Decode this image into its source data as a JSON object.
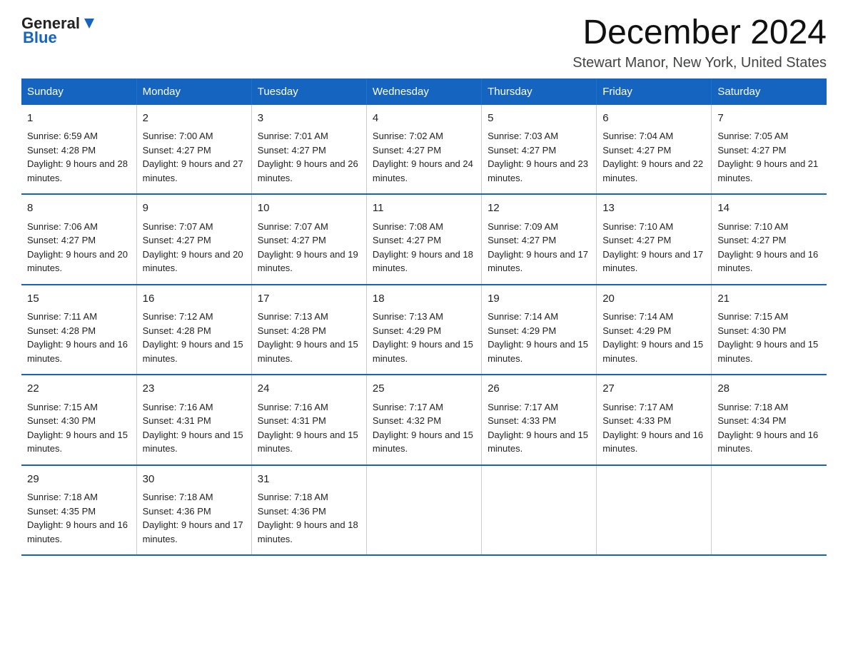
{
  "logo": {
    "general": "General",
    "blue": "Blue"
  },
  "title": "December 2024",
  "location": "Stewart Manor, New York, United States",
  "days_header": [
    "Sunday",
    "Monday",
    "Tuesday",
    "Wednesday",
    "Thursday",
    "Friday",
    "Saturday"
  ],
  "weeks": [
    [
      {
        "day": "1",
        "sunrise": "6:59 AM",
        "sunset": "4:28 PM",
        "daylight": "9 hours and 28 minutes."
      },
      {
        "day": "2",
        "sunrise": "7:00 AM",
        "sunset": "4:27 PM",
        "daylight": "9 hours and 27 minutes."
      },
      {
        "day": "3",
        "sunrise": "7:01 AM",
        "sunset": "4:27 PM",
        "daylight": "9 hours and 26 minutes."
      },
      {
        "day": "4",
        "sunrise": "7:02 AM",
        "sunset": "4:27 PM",
        "daylight": "9 hours and 24 minutes."
      },
      {
        "day": "5",
        "sunrise": "7:03 AM",
        "sunset": "4:27 PM",
        "daylight": "9 hours and 23 minutes."
      },
      {
        "day": "6",
        "sunrise": "7:04 AM",
        "sunset": "4:27 PM",
        "daylight": "9 hours and 22 minutes."
      },
      {
        "day": "7",
        "sunrise": "7:05 AM",
        "sunset": "4:27 PM",
        "daylight": "9 hours and 21 minutes."
      }
    ],
    [
      {
        "day": "8",
        "sunrise": "7:06 AM",
        "sunset": "4:27 PM",
        "daylight": "9 hours and 20 minutes."
      },
      {
        "day": "9",
        "sunrise": "7:07 AM",
        "sunset": "4:27 PM",
        "daylight": "9 hours and 20 minutes."
      },
      {
        "day": "10",
        "sunrise": "7:07 AM",
        "sunset": "4:27 PM",
        "daylight": "9 hours and 19 minutes."
      },
      {
        "day": "11",
        "sunrise": "7:08 AM",
        "sunset": "4:27 PM",
        "daylight": "9 hours and 18 minutes."
      },
      {
        "day": "12",
        "sunrise": "7:09 AM",
        "sunset": "4:27 PM",
        "daylight": "9 hours and 17 minutes."
      },
      {
        "day": "13",
        "sunrise": "7:10 AM",
        "sunset": "4:27 PM",
        "daylight": "9 hours and 17 minutes."
      },
      {
        "day": "14",
        "sunrise": "7:10 AM",
        "sunset": "4:27 PM",
        "daylight": "9 hours and 16 minutes."
      }
    ],
    [
      {
        "day": "15",
        "sunrise": "7:11 AM",
        "sunset": "4:28 PM",
        "daylight": "9 hours and 16 minutes."
      },
      {
        "day": "16",
        "sunrise": "7:12 AM",
        "sunset": "4:28 PM",
        "daylight": "9 hours and 15 minutes."
      },
      {
        "day": "17",
        "sunrise": "7:13 AM",
        "sunset": "4:28 PM",
        "daylight": "9 hours and 15 minutes."
      },
      {
        "day": "18",
        "sunrise": "7:13 AM",
        "sunset": "4:29 PM",
        "daylight": "9 hours and 15 minutes."
      },
      {
        "day": "19",
        "sunrise": "7:14 AM",
        "sunset": "4:29 PM",
        "daylight": "9 hours and 15 minutes."
      },
      {
        "day": "20",
        "sunrise": "7:14 AM",
        "sunset": "4:29 PM",
        "daylight": "9 hours and 15 minutes."
      },
      {
        "day": "21",
        "sunrise": "7:15 AM",
        "sunset": "4:30 PM",
        "daylight": "9 hours and 15 minutes."
      }
    ],
    [
      {
        "day": "22",
        "sunrise": "7:15 AM",
        "sunset": "4:30 PM",
        "daylight": "9 hours and 15 minutes."
      },
      {
        "day": "23",
        "sunrise": "7:16 AM",
        "sunset": "4:31 PM",
        "daylight": "9 hours and 15 minutes."
      },
      {
        "day": "24",
        "sunrise": "7:16 AM",
        "sunset": "4:31 PM",
        "daylight": "9 hours and 15 minutes."
      },
      {
        "day": "25",
        "sunrise": "7:17 AM",
        "sunset": "4:32 PM",
        "daylight": "9 hours and 15 minutes."
      },
      {
        "day": "26",
        "sunrise": "7:17 AM",
        "sunset": "4:33 PM",
        "daylight": "9 hours and 15 minutes."
      },
      {
        "day": "27",
        "sunrise": "7:17 AM",
        "sunset": "4:33 PM",
        "daylight": "9 hours and 16 minutes."
      },
      {
        "day": "28",
        "sunrise": "7:18 AM",
        "sunset": "4:34 PM",
        "daylight": "9 hours and 16 minutes."
      }
    ],
    [
      {
        "day": "29",
        "sunrise": "7:18 AM",
        "sunset": "4:35 PM",
        "daylight": "9 hours and 16 minutes."
      },
      {
        "day": "30",
        "sunrise": "7:18 AM",
        "sunset": "4:36 PM",
        "daylight": "9 hours and 17 minutes."
      },
      {
        "day": "31",
        "sunrise": "7:18 AM",
        "sunset": "4:36 PM",
        "daylight": "9 hours and 18 minutes."
      },
      null,
      null,
      null,
      null
    ]
  ]
}
